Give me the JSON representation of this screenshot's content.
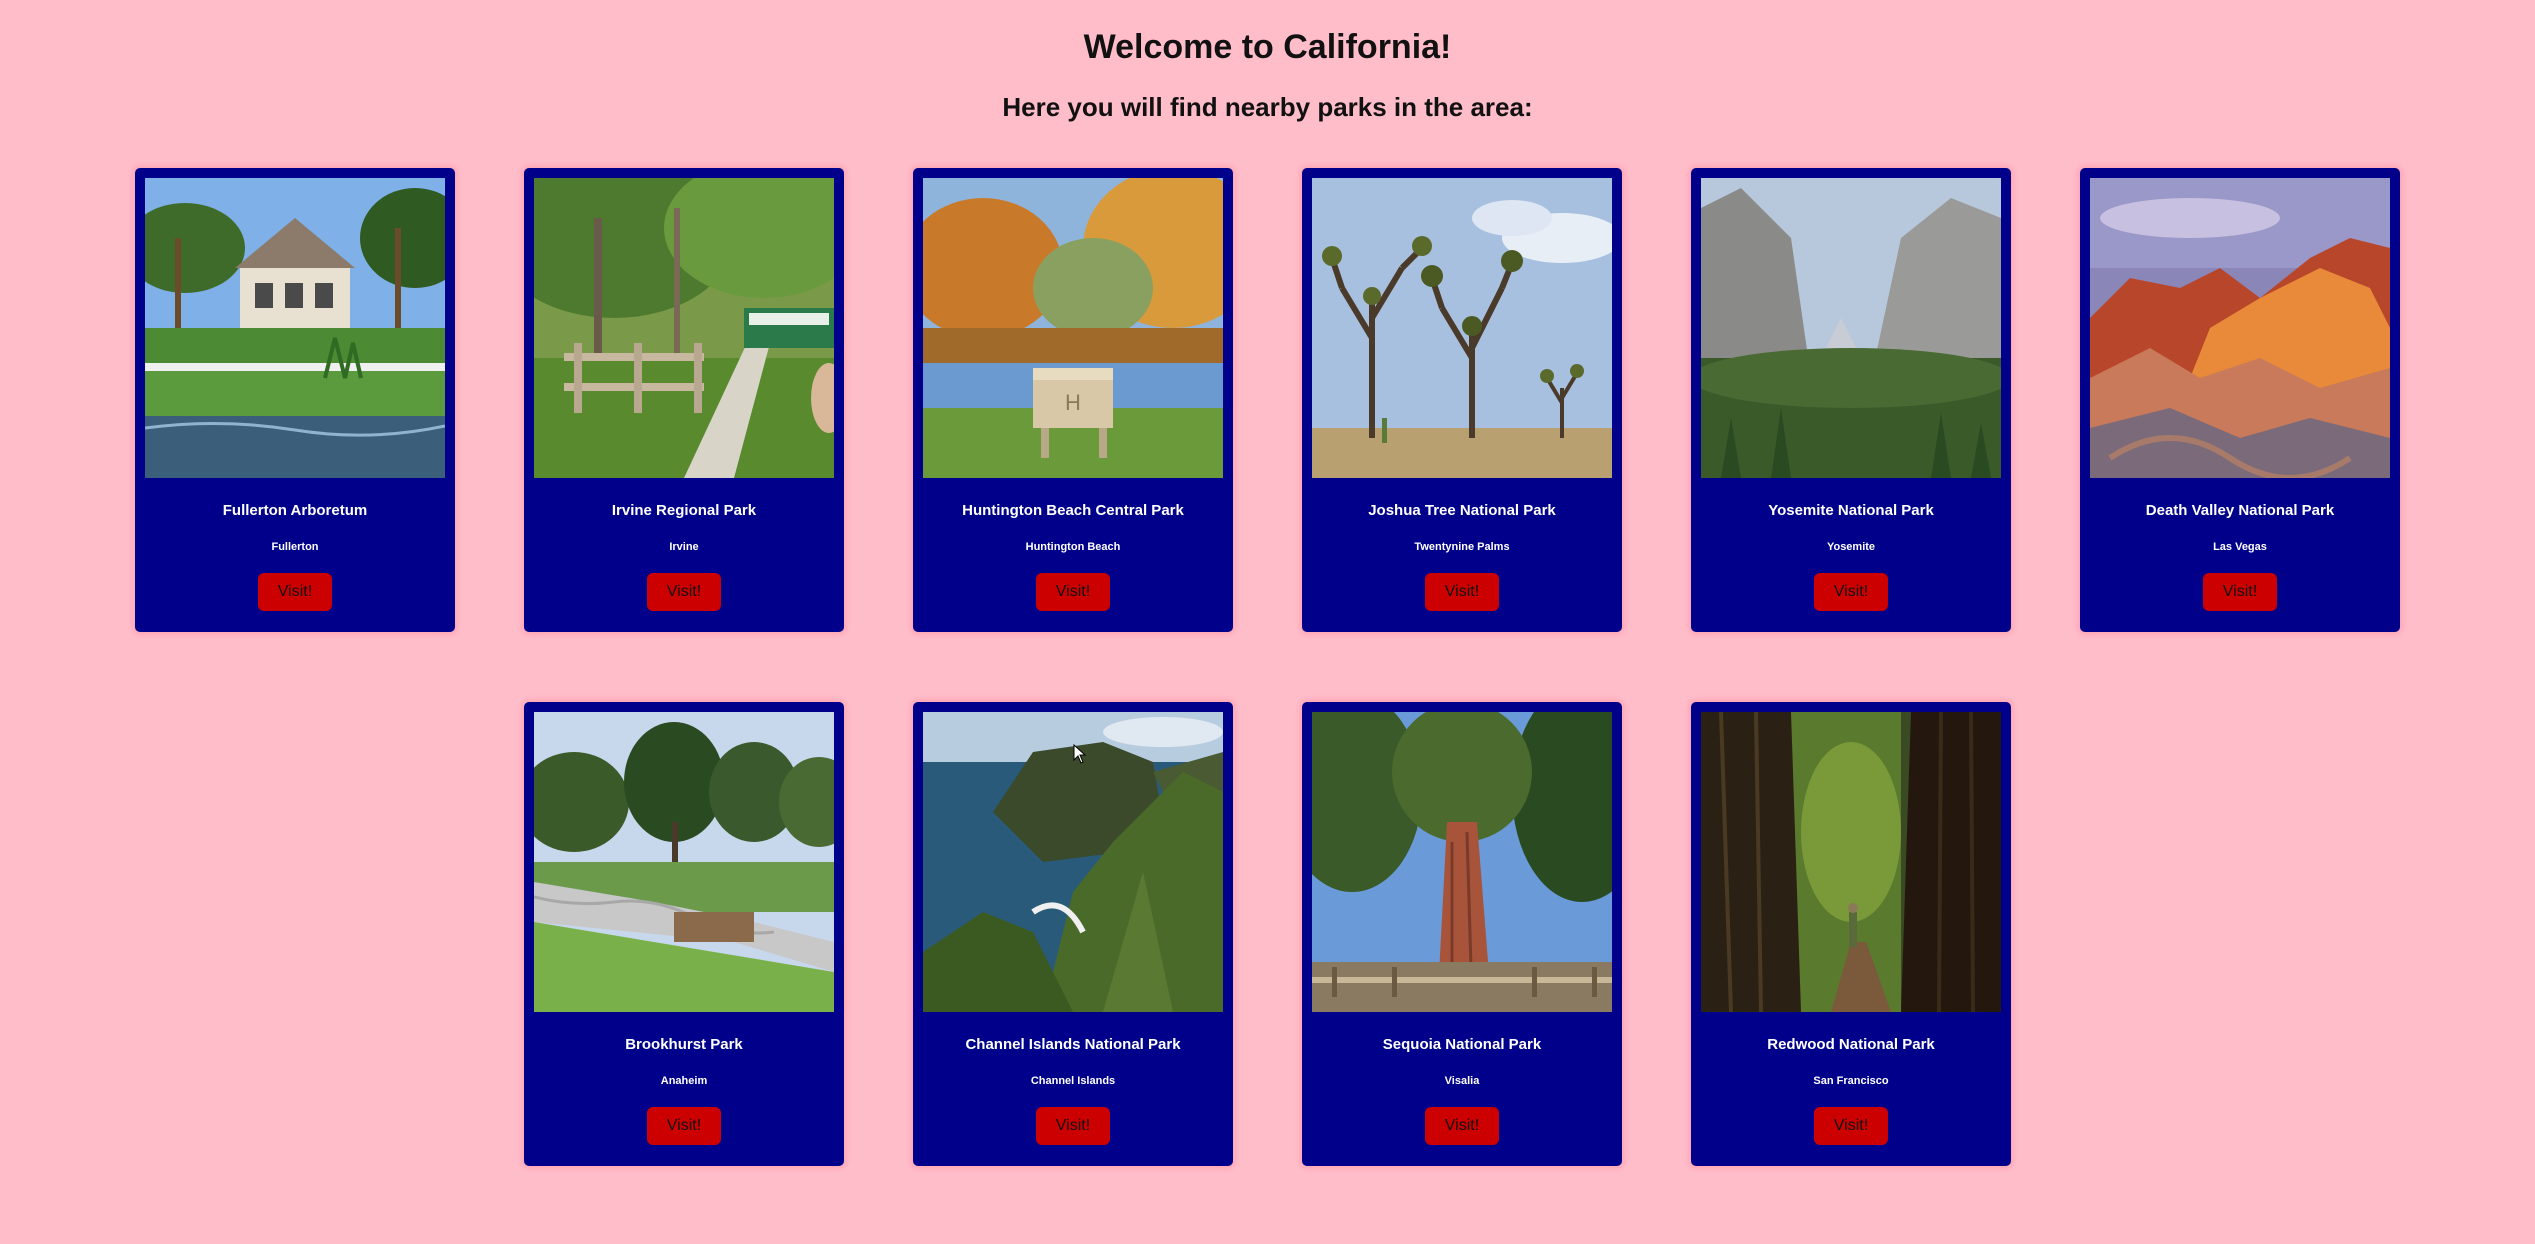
{
  "header": {
    "title": "Welcome to California!",
    "subtitle": "Here you will find nearby parks in the area:"
  },
  "button_label": "Visit!",
  "colors": {
    "background": "#ffbdca",
    "card": "#00008b",
    "button": "#cc0000"
  },
  "parks": [
    {
      "name": "Fullerton Arboretum",
      "city": "Fullerton"
    },
    {
      "name": "Irvine Regional Park",
      "city": "Irvine"
    },
    {
      "name": "Huntington Beach Central Park",
      "city": "Huntington Beach"
    },
    {
      "name": "Joshua Tree National Park",
      "city": "Twentynine Palms"
    },
    {
      "name": "Yosemite National Park",
      "city": "Yosemite"
    },
    {
      "name": "Death Valley National Park",
      "city": "Las Vegas"
    },
    {
      "name": "Brookhurst Park",
      "city": "Anaheim"
    },
    {
      "name": "Channel Islands National Park",
      "city": "Channel Islands"
    },
    {
      "name": "Sequoia National Park",
      "city": "Visalia"
    },
    {
      "name": "Redwood National Park",
      "city": "San Francisco"
    }
  ]
}
